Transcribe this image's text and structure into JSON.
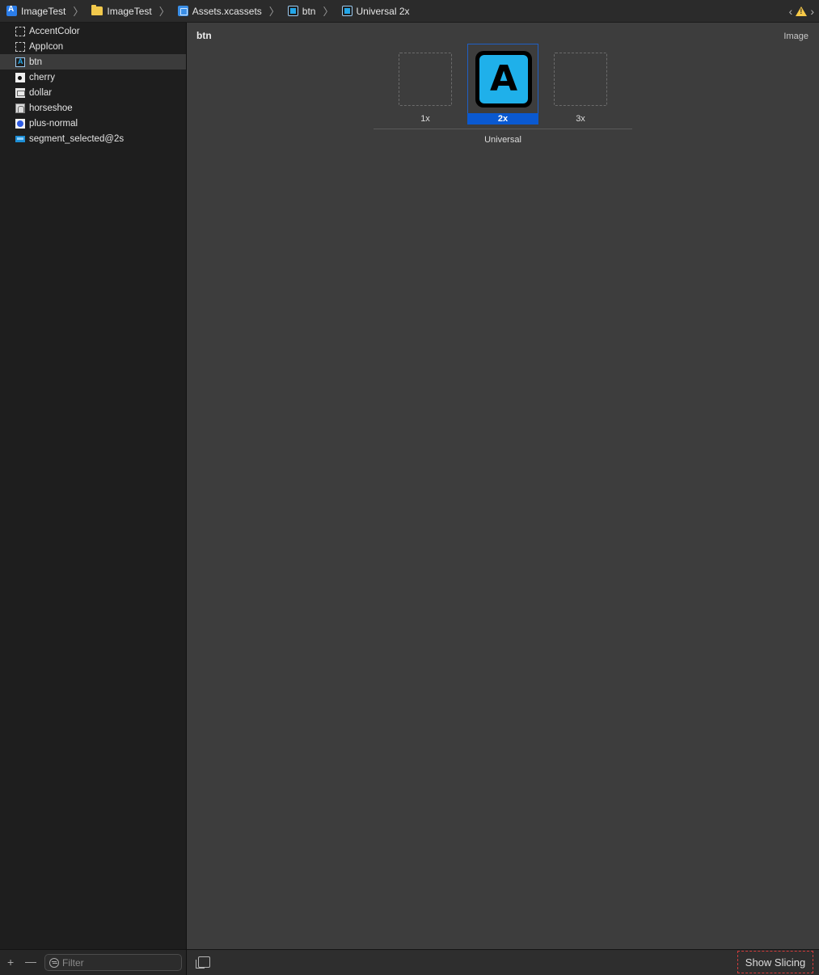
{
  "breadcrumb": [
    {
      "label": "ImageTest",
      "icon": "project-icon"
    },
    {
      "label": "ImageTest",
      "icon": "folder-icon"
    },
    {
      "label": "Assets.xcassets",
      "icon": "asset-catalog-icon"
    },
    {
      "label": "btn",
      "icon": "image-set-icon"
    },
    {
      "label": "Universal 2x",
      "icon": "image-set-icon"
    }
  ],
  "sidebar": {
    "items": [
      {
        "label": "AccentColor",
        "icon": "dashed-placeholder-icon"
      },
      {
        "label": "AppIcon",
        "icon": "dashed-placeholder-icon"
      },
      {
        "label": "btn",
        "icon": "btn-image-icon",
        "selected": true
      },
      {
        "label": "cherry",
        "icon": "cherry-image-icon"
      },
      {
        "label": "dollar",
        "icon": "dollar-image-icon"
      },
      {
        "label": "horseshoe",
        "icon": "horseshoe-image-icon"
      },
      {
        "label": "plus-normal",
        "icon": "plus-image-icon"
      },
      {
        "label": "segment_selected@2s",
        "icon": "segment-image-icon"
      }
    ],
    "filter_placeholder": "Filter"
  },
  "editor": {
    "title": "btn",
    "kind": "Image",
    "slots": [
      {
        "label": "1x",
        "filled": false
      },
      {
        "label": "2x",
        "filled": true,
        "selected": true,
        "image_letter": "A"
      },
      {
        "label": "3x",
        "filled": false
      }
    ],
    "group_label": "Universal",
    "show_slicing_label": "Show Slicing"
  },
  "colors": {
    "selection_blue": "#0a59d1",
    "btn_fill": "#1fb0ea",
    "warning_yellow": "#f7c948"
  }
}
